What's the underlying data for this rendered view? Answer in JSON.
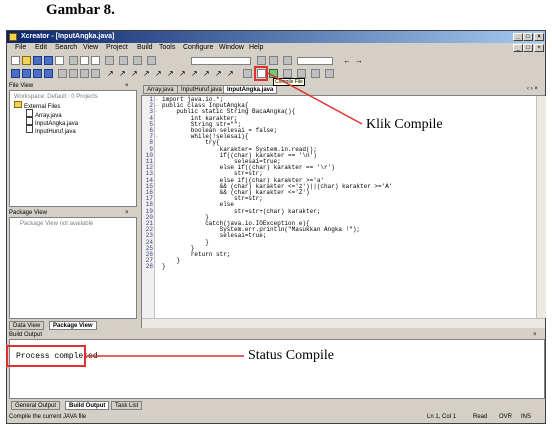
{
  "caption": "Gambar 8.",
  "window": {
    "title": "Xcreator - [InputAngka.java]"
  },
  "menu": [
    "File",
    "Edit",
    "Search",
    "View",
    "Project",
    "Build",
    "Tools",
    "Configure",
    "Window",
    "Help"
  ],
  "file_view": {
    "title": "File View",
    "workspace": "Workspace: Default : 0 Projects",
    "external_files": "External Files",
    "files": [
      "Array.java",
      "InputAngka.java",
      "InputHuruf.java"
    ]
  },
  "package_view": {
    "title": "Package View",
    "message": "Package View not available"
  },
  "left_tabs": [
    "Data View",
    "Package View"
  ],
  "editor_tabs": [
    "Array.java",
    "InputHuruf.java",
    "InputAngka.java"
  ],
  "tooltip": "Compile File",
  "code_lines": [
    "import java.io.*;",
    "public class InputAngka{",
    "    public static String BacaAngka(){",
    "        int karakter;",
    "        String str=\"\";",
    "        boolean selesai = false;",
    "        while(!selesai){",
    "            try{",
    "                karakter= System.in.read();",
    "                if((char) karakter == '\\n')",
    "                    selesai=true;",
    "                else if((char) karakter == '\\r')",
    "                    str=str;",
    "                else if((char) karakter >='a'",
    "                && (char) karakter <='z')||(char) karakter >='A'",
    "                && (char) karakter <='Z')",
    "                    str=str;",
    "                else",
    "                    str=str+(char) karakter;",
    "            }",
    "            catch(java.io.IOException e){",
    "                System.err.println(\"Masukkan Angka !\");",
    "                selesai=true;",
    "            }",
    "        }",
    "        return str;",
    "    }",
    "}"
  ],
  "build_output": {
    "title": "Build Output",
    "text": "Process completed"
  },
  "bottom_tabs": [
    "General Output",
    "Build Output",
    "Task List"
  ],
  "status": {
    "text": "Compile the current JAVA file",
    "right": "Ln 1, Col 1",
    "mode": "Read",
    "ovr": "OVR",
    "insert": "INS"
  },
  "annotations": {
    "compile": "Klik Compile",
    "status": "Status Compile"
  },
  "colors": {
    "highlight": "#e03030",
    "titlebar": "#0a246a"
  }
}
